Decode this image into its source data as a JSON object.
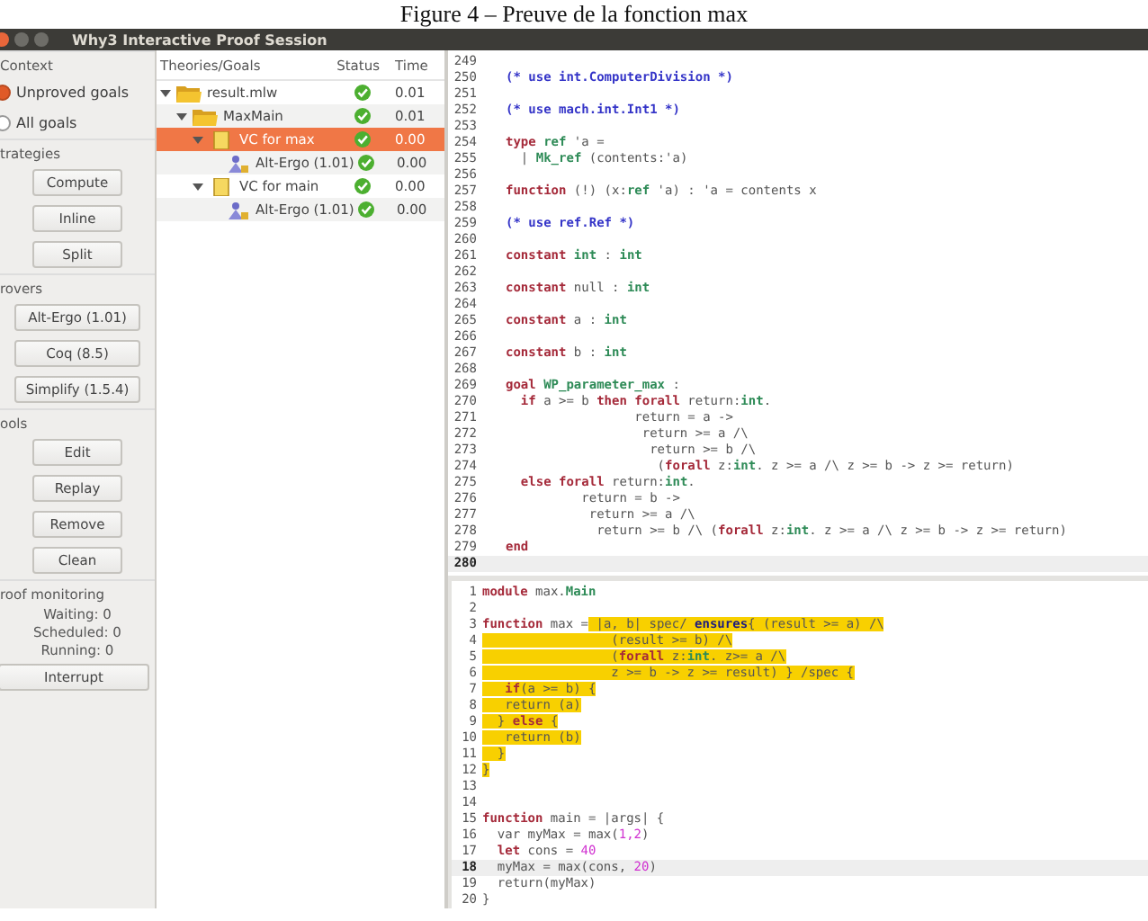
{
  "caption": "Figure 4 – Preuve de la fonction max",
  "window": {
    "title": "Why3 Interactive Proof Session"
  },
  "sidebar": {
    "context": {
      "title": "Context",
      "options": [
        {
          "label": "Unproved goals",
          "selected": true
        },
        {
          "label": "All goals",
          "selected": false
        }
      ]
    },
    "strategies": {
      "title": "trategies",
      "buttons": [
        "Compute",
        "Inline",
        "Split"
      ]
    },
    "provers": {
      "title": "rovers",
      "buttons": [
        "Alt-Ergo (1.01)",
        "Coq (8.5)",
        "Simplify (1.5.4)"
      ]
    },
    "tools": {
      "title": "ools",
      "buttons": [
        "Edit",
        "Replay",
        "Remove",
        "Clean"
      ]
    },
    "monitoring": {
      "title": "roof monitoring",
      "counters": [
        "Waiting: 0",
        "Scheduled: 0",
        "Running: 0"
      ],
      "button": "Interrupt"
    }
  },
  "tree": {
    "columns": [
      "Theories/Goals",
      "Status",
      "Time"
    ],
    "rows": [
      {
        "kind": "file",
        "name": "result.mlw",
        "proved": true,
        "time": "0.01",
        "expanded": true,
        "selected": false,
        "children": [
          {
            "kind": "theory",
            "name": "MaxMain",
            "proved": true,
            "time": "0.01",
            "expanded": true,
            "selected": false,
            "children": [
              {
                "kind": "goal",
                "name": "VC for max",
                "proved": true,
                "time": "0.00",
                "expanded": true,
                "selected": true,
                "children": [
                  {
                    "kind": "prover",
                    "name": "Alt-Ergo (1.01)",
                    "proved": true,
                    "time": "0.00",
                    "selected": false
                  }
                ]
              },
              {
                "kind": "goal",
                "name": "VC for main",
                "proved": true,
                "time": "0.00",
                "expanded": true,
                "selected": false,
                "children": [
                  {
                    "kind": "prover",
                    "name": "Alt-Ergo (1.01)",
                    "proved": true,
                    "time": "0.00",
                    "selected": false
                  }
                ]
              }
            ]
          }
        ]
      }
    ]
  },
  "task_view": {
    "lines": [
      {
        "n": "249",
        "current": false
      },
      {
        "n": "250",
        "current": false,
        "segs": [
          {
            "t": "(* use int.ComputerDivision *)",
            "kind": "comment"
          }
        ]
      },
      {
        "n": "251",
        "current": false
      },
      {
        "n": "252",
        "current": false,
        "segs": [
          {
            "t": "(* use mach.int.Int1 *)",
            "kind": "comment"
          }
        ]
      },
      {
        "n": "253",
        "current": false
      },
      {
        "n": "254",
        "current": false,
        "segs": [
          {
            "t": "type",
            "kind": "keyword"
          },
          {
            "t": " ref",
            "kind": "type"
          },
          {
            "t": " 'a =",
            "kind": "plain"
          }
        ]
      },
      {
        "n": "255",
        "current": false,
        "segs": [
          {
            "t": "  |",
            "kind": "plain"
          },
          {
            "t": " Mk_ref",
            "kind": "type"
          },
          {
            "t": " (contents:'a)",
            "kind": "plain"
          }
        ]
      },
      {
        "n": "256",
        "current": false
      },
      {
        "n": "257",
        "current": false,
        "segs": [
          {
            "t": "function",
            "kind": "keyword"
          },
          {
            "t": " (!) (x:",
            "kind": "plain"
          },
          {
            "t": "ref",
            "kind": "type"
          },
          {
            "t": " 'a) : 'a = contents x",
            "kind": "plain"
          }
        ]
      },
      {
        "n": "258",
        "current": false
      },
      {
        "n": "259",
        "current": false,
        "segs": [
          {
            "t": "(* use ref.Ref *)",
            "kind": "comment"
          }
        ]
      },
      {
        "n": "260",
        "current": false
      },
      {
        "n": "261",
        "current": false,
        "segs": [
          {
            "t": "constant",
            "kind": "keyword"
          },
          {
            "t": " int",
            "kind": "type"
          },
          {
            "t": " :",
            "kind": "plain"
          },
          {
            "t": " int",
            "kind": "type"
          }
        ]
      },
      {
        "n": "262",
        "current": false
      },
      {
        "n": "263",
        "current": false,
        "segs": [
          {
            "t": "constant",
            "kind": "keyword"
          },
          {
            "t": " null :",
            "kind": "plain"
          },
          {
            "t": " int",
            "kind": "type"
          }
        ]
      },
      {
        "n": "264",
        "current": false
      },
      {
        "n": "265",
        "current": false,
        "segs": [
          {
            "t": "constant",
            "kind": "keyword"
          },
          {
            "t": " a :",
            "kind": "plain"
          },
          {
            "t": " int",
            "kind": "type"
          }
        ]
      },
      {
        "n": "266",
        "current": false
      },
      {
        "n": "267",
        "current": false,
        "segs": [
          {
            "t": "constant",
            "kind": "keyword"
          },
          {
            "t": " b :",
            "kind": "plain"
          },
          {
            "t": " int",
            "kind": "type"
          }
        ]
      },
      {
        "n": "268",
        "current": false
      },
      {
        "n": "269",
        "current": false,
        "segs": [
          {
            "t": "goal",
            "kind": "keyword"
          },
          {
            "t": " WP_parameter_max",
            "kind": "type"
          },
          {
            "t": " :",
            "kind": "plain"
          }
        ]
      },
      {
        "n": "270",
        "current": false,
        "segs": [
          {
            "t": "  if",
            "kind": "keyword"
          },
          {
            "t": " a >= b",
            "kind": "plain"
          },
          {
            "t": " then forall",
            "kind": "keyword"
          },
          {
            "t": " return:",
            "kind": "plain"
          },
          {
            "t": "int",
            "kind": "type"
          },
          {
            "t": ".",
            "kind": "plain"
          }
        ]
      },
      {
        "n": "271",
        "current": false,
        "segs": [
          {
            "t": "                 return = a ->",
            "kind": "plain"
          }
        ]
      },
      {
        "n": "272",
        "current": false,
        "segs": [
          {
            "t": "                  return >= a /\\",
            "kind": "plain"
          }
        ]
      },
      {
        "n": "273",
        "current": false,
        "segs": [
          {
            "t": "                   return >= b /\\",
            "kind": "plain"
          }
        ]
      },
      {
        "n": "274",
        "current": false,
        "segs": [
          {
            "t": "                    (",
            "kind": "plain"
          },
          {
            "t": "forall",
            "kind": "keyword"
          },
          {
            "t": " z:",
            "kind": "plain"
          },
          {
            "t": "int",
            "kind": "type"
          },
          {
            "t": ". z >= a /\\ z >= b -> z >= return)",
            "kind": "plain"
          }
        ]
      },
      {
        "n": "275",
        "current": false,
        "segs": [
          {
            "t": "  else forall",
            "kind": "keyword"
          },
          {
            "t": " return:",
            "kind": "plain"
          },
          {
            "t": "int",
            "kind": "type"
          },
          {
            "t": ".",
            "kind": "plain"
          }
        ]
      },
      {
        "n": "276",
        "current": false,
        "segs": [
          {
            "t": "          return = b ->",
            "kind": "plain"
          }
        ]
      },
      {
        "n": "277",
        "current": false,
        "segs": [
          {
            "t": "           return >= a /\\",
            "kind": "plain"
          }
        ]
      },
      {
        "n": "278",
        "current": false,
        "segs": [
          {
            "t": "            return >= b /\\ (",
            "kind": "plain"
          },
          {
            "t": "forall",
            "kind": "keyword"
          },
          {
            "t": " z:",
            "kind": "plain"
          },
          {
            "t": "int",
            "kind": "type"
          },
          {
            "t": ". z >= a /\\ z >= b -> z >= return)",
            "kind": "plain"
          }
        ]
      },
      {
        "n": "279",
        "current": false,
        "segs": [
          {
            "t": "end",
            "kind": "keyword"
          }
        ]
      },
      {
        "n": "280",
        "current": true
      }
    ]
  },
  "source_view": {
    "lines": [
      {
        "n": "1",
        "current": false,
        "segs": [
          {
            "t": "module",
            "kind": "keyword",
            "highlighted": false
          },
          {
            "t": " max.",
            "kind": "plain",
            "highlighted": false
          },
          {
            "t": "Main",
            "kind": "type",
            "highlighted": false
          }
        ]
      },
      {
        "n": "2",
        "current": false
      },
      {
        "n": "3",
        "current": false,
        "segs": [
          {
            "t": "function",
            "kind": "keyword",
            "highlighted": false
          },
          {
            "t": " max =",
            "kind": "plain",
            "highlighted": false
          },
          {
            "t": " |a, b| spec/",
            "kind": "plain",
            "highlighted": true
          },
          {
            "t": " ensures",
            "kind": "spec",
            "highlighted": true
          },
          {
            "t": "{ (result >= a) /\\",
            "kind": "plain",
            "highlighted": true
          }
        ]
      },
      {
        "n": "4",
        "current": false,
        "segs": [
          {
            "t": "                 (result >= b) /\\",
            "kind": "plain",
            "highlighted": true
          }
        ]
      },
      {
        "n": "5",
        "current": false,
        "segs": [
          {
            "t": "                 (",
            "kind": "plain",
            "highlighted": true
          },
          {
            "t": "forall",
            "kind": "keyword",
            "highlighted": true
          },
          {
            "t": " z:",
            "kind": "plain",
            "highlighted": true
          },
          {
            "t": "int",
            "kind": "type",
            "highlighted": true
          },
          {
            "t": ". z>= a /\\",
            "kind": "plain",
            "highlighted": true
          }
        ]
      },
      {
        "n": "6",
        "current": false,
        "segs": [
          {
            "t": "                 z >= b -> z >= result) } /spec {",
            "kind": "plain",
            "highlighted": true
          }
        ]
      },
      {
        "n": "7",
        "current": false,
        "segs": [
          {
            "t": "   if",
            "kind": "keyword",
            "highlighted": true
          },
          {
            "t": "(a >= b) {",
            "kind": "plain",
            "highlighted": true
          }
        ]
      },
      {
        "n": "8",
        "current": false,
        "segs": [
          {
            "t": "   return (a)",
            "kind": "plain",
            "highlighted": true
          }
        ]
      },
      {
        "n": "9",
        "current": false,
        "segs": [
          {
            "t": "  }",
            "kind": "plain",
            "highlighted": true
          },
          {
            "t": " else",
            "kind": "keyword",
            "highlighted": true
          },
          {
            "t": " {",
            "kind": "plain",
            "highlighted": true
          }
        ]
      },
      {
        "n": "10",
        "current": false,
        "segs": [
          {
            "t": "   return (b)",
            "kind": "plain",
            "highlighted": true
          }
        ]
      },
      {
        "n": "11",
        "current": false,
        "segs": [
          {
            "t": "  }",
            "kind": "plain",
            "highlighted": true
          }
        ]
      },
      {
        "n": "12",
        "current": false,
        "segs": [
          {
            "t": "}",
            "kind": "plain",
            "highlighted": true
          }
        ]
      },
      {
        "n": "13",
        "current": false
      },
      {
        "n": "14",
        "current": false
      },
      {
        "n": "15",
        "current": false,
        "segs": [
          {
            "t": "function",
            "kind": "keyword",
            "highlighted": false
          },
          {
            "t": " main = |args| {",
            "kind": "plain",
            "highlighted": false
          }
        ]
      },
      {
        "n": "16",
        "current": false,
        "segs": [
          {
            "t": "  var myMax = max(",
            "kind": "plain",
            "highlighted": false
          },
          {
            "t": "1,2",
            "kind": "number",
            "highlighted": false
          },
          {
            "t": ")",
            "kind": "plain",
            "highlighted": false
          }
        ]
      },
      {
        "n": "17",
        "current": false,
        "segs": [
          {
            "t": "  let",
            "kind": "keyword",
            "highlighted": false
          },
          {
            "t": " cons =",
            "kind": "plain",
            "highlighted": false
          },
          {
            "t": " 40",
            "kind": "number",
            "highlighted": false
          }
        ]
      },
      {
        "n": "18",
        "current": true,
        "segs": [
          {
            "t": "  myMax = max(cons,",
            "kind": "plain",
            "highlighted": false
          },
          {
            "t": " 20",
            "kind": "number",
            "highlighted": false
          },
          {
            "t": ")",
            "kind": "plain",
            "highlighted": false
          }
        ]
      },
      {
        "n": "19",
        "current": false,
        "segs": [
          {
            "t": "  return(myMax)",
            "kind": "plain",
            "highlighted": false
          }
        ]
      },
      {
        "n": "20",
        "current": false,
        "segs": [
          {
            "t": "}",
            "kind": "plain",
            "highlighted": false
          }
        ]
      }
    ]
  }
}
